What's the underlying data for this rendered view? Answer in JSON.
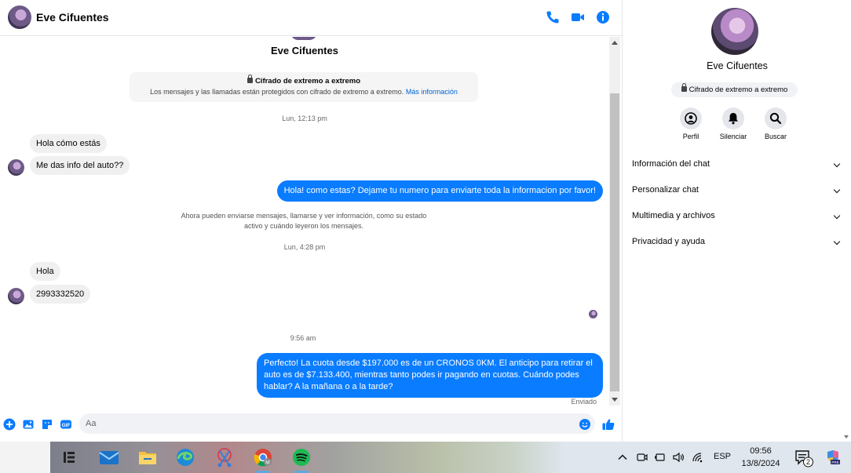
{
  "header": {
    "contact_name": "Eve Cifuentes"
  },
  "conversation": {
    "contact_name": "Eve Cifuentes",
    "e2ee_title": "Cifrado de extremo a extremo",
    "e2ee_text": "Los mensajes y las llamadas están protegidos con cifrado de extremo a extremo.",
    "e2ee_link": "Más información",
    "timestamp_1": "Lun, 12:13 pm",
    "msg_in_1": "Hola cómo estás",
    "msg_in_2": "Me das info del auto??",
    "msg_out_1": "Hola! como estas? Dejame tu numero para enviarte toda la informacion por favor!",
    "sysnote_line1": "Ahora pueden enviarse mensajes, llamarse y ver información, como su estado",
    "sysnote_line2": "activo y cuándo leyeron los mensajes.",
    "timestamp_2": "Lun, 4:28 pm",
    "msg_in_3": "Hola",
    "msg_in_4": "2993332520",
    "timestamp_3": "9:56 am",
    "msg_out_2": "Perfecto! La cuota desde $197.000 es de un CRONOS 0KM. El anticipo para retirar el auto es de $7.133.400, mientras tanto podes ir pagando en cuotas. Cuándo podes hablar? A la mañana o a la tarde?",
    "sent_status": "Enviado"
  },
  "composer": {
    "placeholder": "Aa"
  },
  "side_panel": {
    "name": "Eve Cifuentes",
    "badge": "Cifrado de extremo a extremo",
    "actions": [
      "Perfil",
      "Silenciar",
      "Buscar"
    ],
    "sections": [
      "Información del chat",
      "Personalizar chat",
      "Multimedia y archivos",
      "Privacidad y ayuda"
    ]
  },
  "taskbar": {
    "language": "ESP",
    "time": "09:56",
    "date": "13/8/2024",
    "notification_count": "2"
  },
  "colors": {
    "accent": "#0a7cff",
    "link": "#0064d1"
  }
}
